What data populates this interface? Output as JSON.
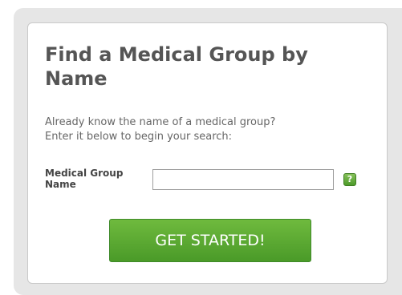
{
  "panel": {
    "title": "Find a Medical Group by Name",
    "intro_line1": "Already know the name of a medical group?",
    "intro_line2": "Enter it below to begin your search:"
  },
  "search": {
    "label": "Medical Group Name",
    "value": "",
    "placeholder": ""
  },
  "help_icon": {
    "glyph": "?",
    "name": "help-icon",
    "color": "#5aa632"
  },
  "cta": {
    "label": "GET STARTED!",
    "color": "#56a630"
  }
}
